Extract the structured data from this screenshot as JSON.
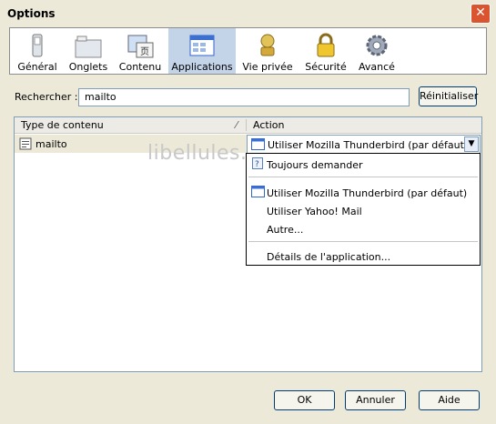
{
  "window": {
    "title": "Options"
  },
  "toolbar": {
    "panes": [
      {
        "label": "Général",
        "icon": "general-icon"
      },
      {
        "label": "Onglets",
        "icon": "tabs-icon"
      },
      {
        "label": "Contenu",
        "icon": "content-icon"
      },
      {
        "label": "Applications",
        "icon": "applications-icon",
        "selected": true
      },
      {
        "label": "Vie privée",
        "icon": "privacy-icon"
      },
      {
        "label": "Sécurité",
        "icon": "lock-icon"
      },
      {
        "label": "Avancé",
        "icon": "gear-icon"
      }
    ]
  },
  "search": {
    "label": "Rechercher :",
    "value": "mailto",
    "reset_label": "Réinitialiser"
  },
  "table": {
    "columns": [
      "Type de contenu",
      "Action"
    ],
    "rows": [
      {
        "type": "mailto",
        "action": "Utiliser Mozilla Thunderbird (par défaut)"
      }
    ]
  },
  "dropdown": {
    "options": [
      "Toujours demander",
      "Utiliser Mozilla Thunderbird (par défaut)",
      "Utiliser Yahoo! Mail",
      "Autre...",
      "Détails de l'application..."
    ]
  },
  "watermark": "libellules.ch",
  "buttons": {
    "ok": "OK",
    "cancel": "Annuler",
    "help": "Aide"
  }
}
